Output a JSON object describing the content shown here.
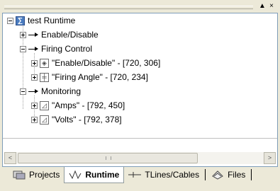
{
  "titlebar": {
    "minimize_glyph": "▲",
    "close_glyph": "×"
  },
  "tree": {
    "root": {
      "label": "test Runtime",
      "icon": "runtime-project-icon"
    },
    "items": [
      {
        "label": "Enable/Disable",
        "expanded": false,
        "icon": "signal-arrow-icon"
      },
      {
        "label": "Firing Control",
        "expanded": true,
        "icon": "signal-arrow-icon"
      },
      {
        "label": "\"Enable/Disable\" - [720, 306]",
        "icon": "switch-control-icon"
      },
      {
        "label": "\"Firing Angle\" - [720, 234]",
        "icon": "slider-control-icon"
      },
      {
        "label": "Monitoring",
        "expanded": true,
        "icon": "signal-arrow-icon"
      },
      {
        "label": "\"Amps\" - [792, 450]",
        "icon": "meter-icon"
      },
      {
        "label": "\"Volts\" - [792, 378]",
        "icon": "meter-icon"
      }
    ]
  },
  "scrollbar": {
    "left_glyph": "<",
    "right_glyph": ">"
  },
  "tabs": [
    {
      "label": "Projects",
      "icon": "projects-icon",
      "active": false
    },
    {
      "label": "Runtime",
      "icon": "runtime-wave-icon",
      "active": true
    },
    {
      "label": "TLines/Cables",
      "icon": "tline-icon",
      "active": false
    },
    {
      "label": "Files",
      "icon": "files-icon",
      "active": false
    }
  ]
}
